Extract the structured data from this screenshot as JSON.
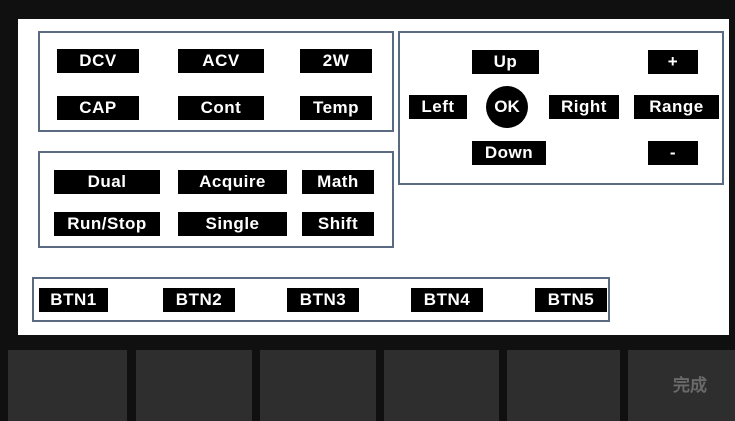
{
  "meas_keys": {
    "dcv": "DCV",
    "acv": "ACV",
    "w2": "2W",
    "cap": "CAP",
    "cont": "Cont",
    "temp": "Temp"
  },
  "nav_keys": {
    "up": "Up",
    "plus": "+",
    "left": "Left",
    "ok": "OK",
    "right": "Right",
    "range": "Range",
    "down": "Down",
    "minus": "-"
  },
  "ctrl_keys": {
    "dual": "Dual",
    "acquire": "Acquire",
    "math": "Math",
    "runstop": "Run/Stop",
    "single": "Single",
    "shift": "Shift"
  },
  "buttons": [
    "BTN1",
    "BTN2",
    "BTN3",
    "BTN4",
    "BTN5"
  ],
  "softkeys": [
    "",
    "",
    "",
    "",
    "",
    "完成"
  ],
  "colors": {
    "screen_bg": "#ffffff",
    "key_bg": "#000000",
    "frame": "#5a6a82",
    "softkey_bg": "#2e2e2e",
    "softkey_text": "#6a6a6a"
  }
}
